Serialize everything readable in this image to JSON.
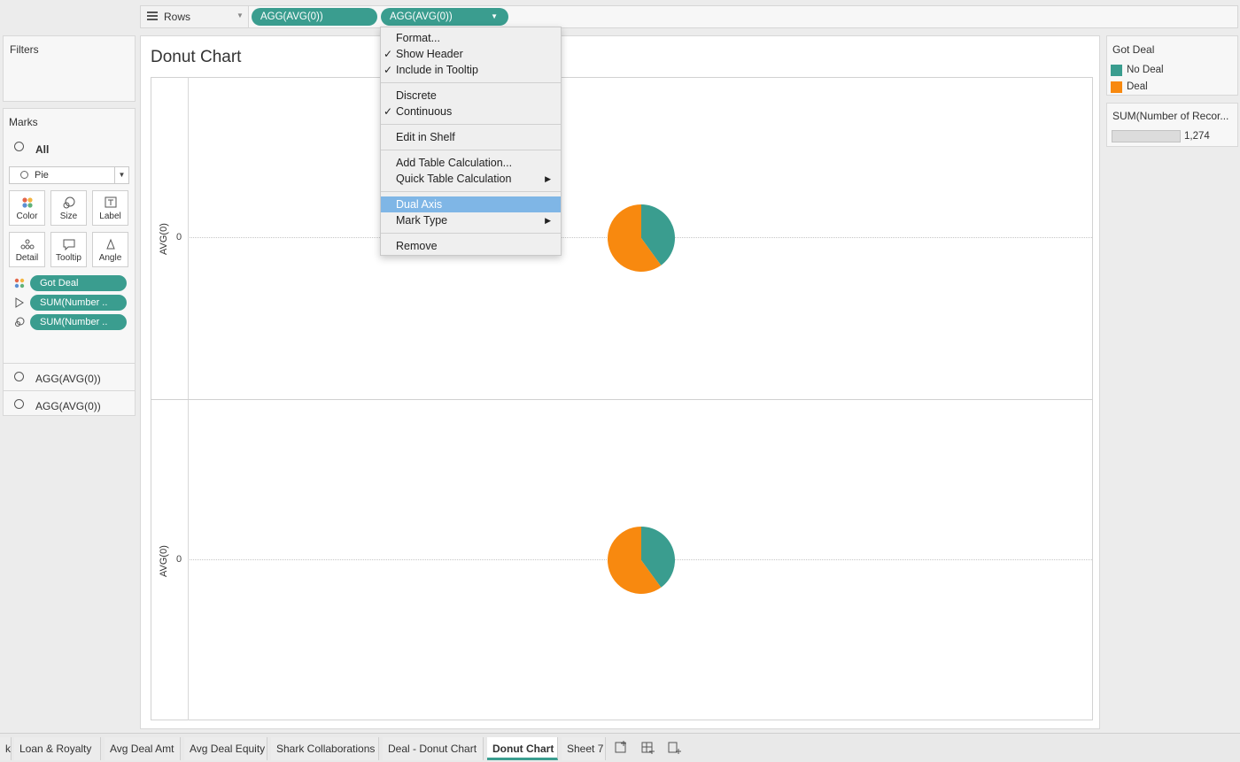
{
  "rows_shelf": {
    "label": "Rows",
    "pills": [
      "AGG(AVG(0))",
      "AGG(AVG(0))"
    ]
  },
  "filters": {
    "title": "Filters"
  },
  "marks": {
    "title": "Marks",
    "all_label": "All",
    "mark_type": "Pie",
    "buttons": [
      "Color",
      "Size",
      "Label",
      "Detail",
      "Tooltip",
      "Angle"
    ],
    "fields": [
      "Got Deal",
      "SUM(Number ..",
      "SUM(Number .."
    ],
    "axis_cards": [
      "AGG(AVG(0))",
      "AGG(AVG(0))"
    ]
  },
  "view": {
    "title": "Donut Chart",
    "axis_title": "AVG(0)",
    "axis_tick": "0"
  },
  "context_menu": {
    "groups": [
      [
        {
          "label": "Format...",
          "checked": false
        },
        {
          "label": "Show Header",
          "checked": true
        },
        {
          "label": "Include in Tooltip",
          "checked": true
        }
      ],
      [
        {
          "label": "Discrete",
          "checked": false
        },
        {
          "label": "Continuous",
          "checked": true
        }
      ],
      [
        {
          "label": "Edit in Shelf",
          "checked": false
        }
      ],
      [
        {
          "label": "Add Table Calculation...",
          "checked": false
        },
        {
          "label": "Quick Table Calculation",
          "checked": false,
          "submenu": true
        }
      ],
      [
        {
          "label": "Dual Axis",
          "checked": false,
          "highlighted": true
        },
        {
          "label": "Mark Type",
          "checked": false,
          "submenu": true
        }
      ],
      [
        {
          "label": "Remove",
          "checked": false
        }
      ]
    ],
    "check_glyph": "✓",
    "submenu_glyph": "▶"
  },
  "legends": {
    "color": {
      "title": "Got Deal",
      "items": [
        {
          "label": "No Deal",
          "color": "#3a9d8f"
        },
        {
          "label": "Deal",
          "color": "#f8890f"
        }
      ]
    },
    "size": {
      "title": "SUM(Number of Recor...",
      "value": "1,274"
    }
  },
  "chart_data": {
    "type": "pie",
    "series": [
      {
        "name": "No Deal",
        "value": 40,
        "color": "#3a9d8f"
      },
      {
        "name": "Deal",
        "value": 60,
        "color": "#f8890f"
      }
    ],
    "panes": 2
  },
  "tabs": {
    "items": [
      "k",
      "Loan & Royalty",
      "Avg Deal Amt",
      "Avg Deal Equity",
      "Shark Collaborations",
      "Deal - Donut Chart",
      "Donut Chart",
      "Sheet 7"
    ],
    "active": "Donut Chart",
    "icons": [
      "new-worksheet-icon",
      "new-dashboard-icon",
      "new-story-icon"
    ]
  }
}
